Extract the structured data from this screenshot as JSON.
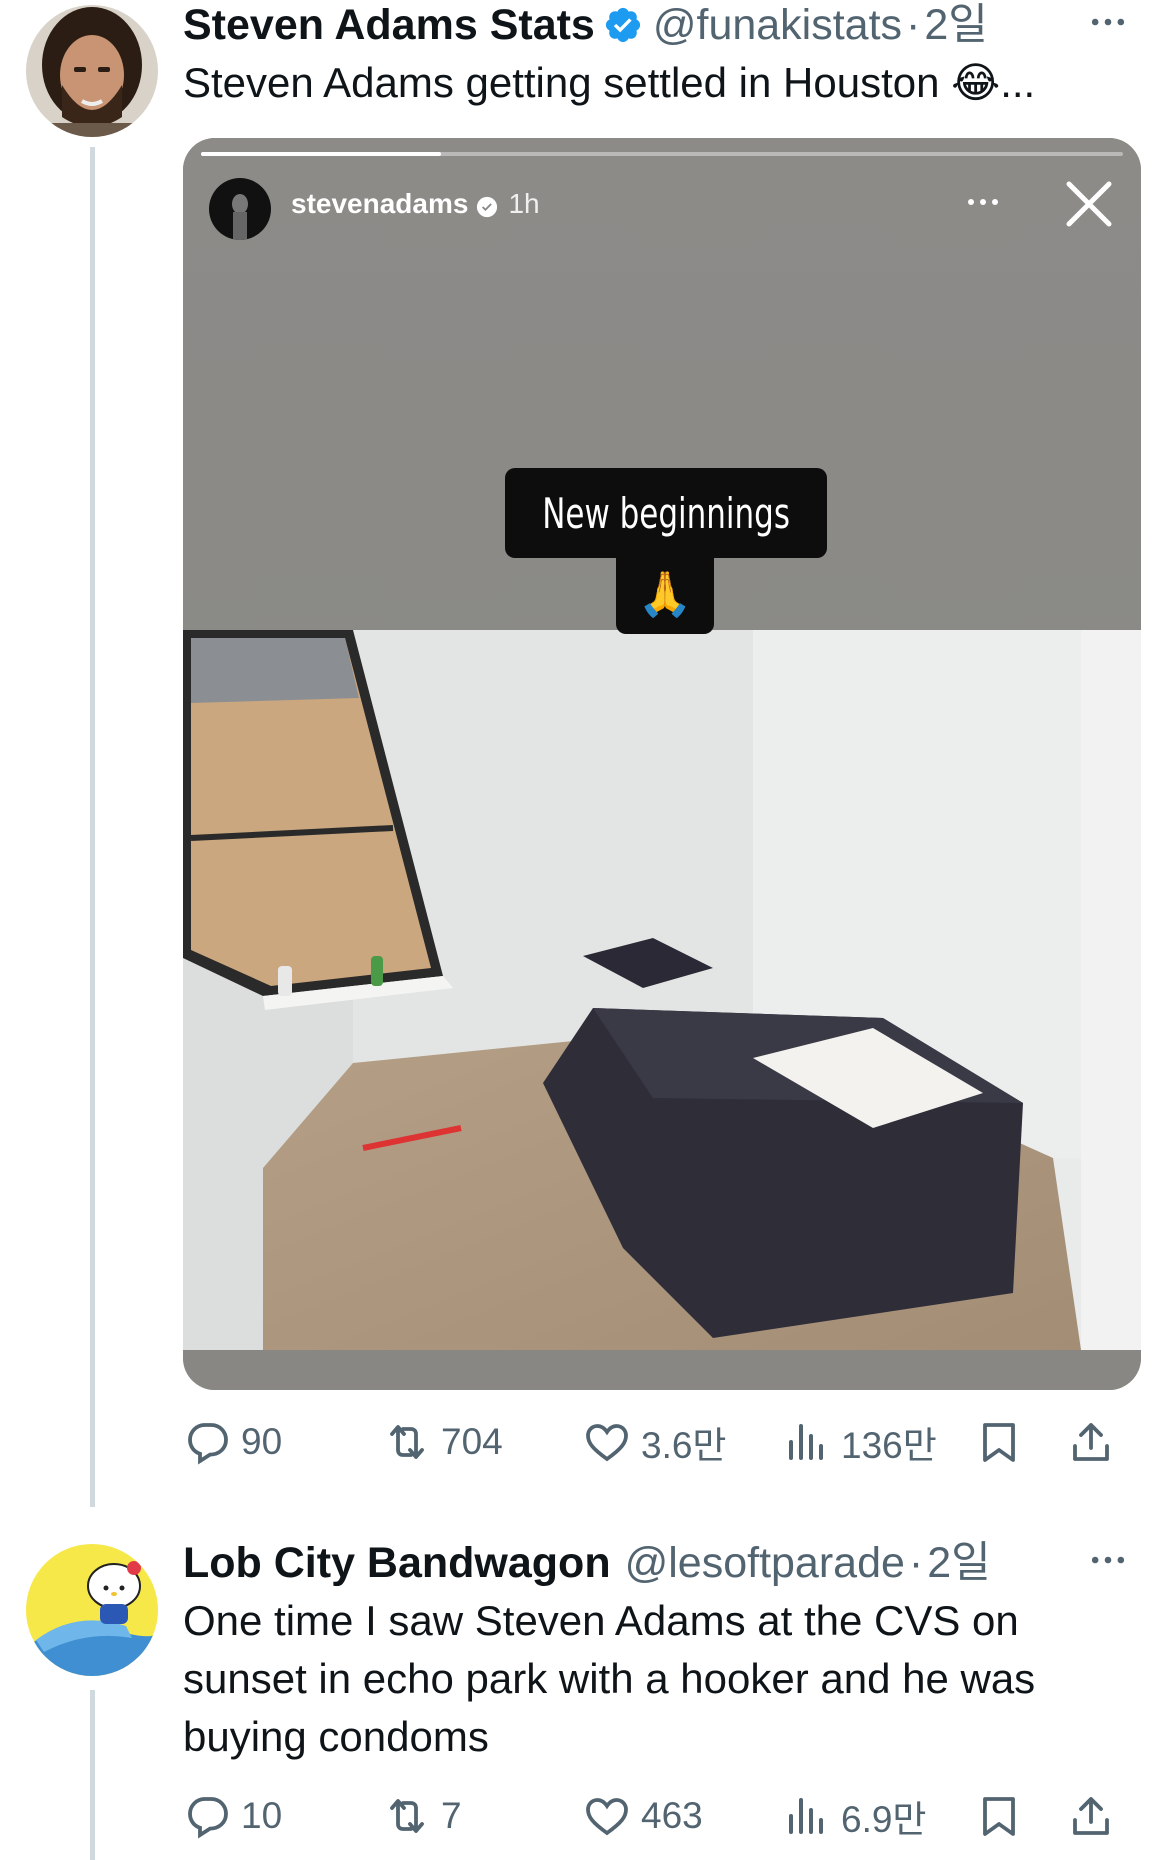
{
  "tweets": [
    {
      "name": "Steven Adams Stats",
      "handle": "@funakistats",
      "sep": "·",
      "time": "2일",
      "text": "Steven Adams getting settled in Houston 😂...",
      "story": {
        "username": "stevenadams",
        "time": "1h",
        "sticker_line1": "New beginnings",
        "sticker_emoji": "🙏"
      },
      "stats": {
        "replies": "90",
        "retweets": "704",
        "likes": "3.6만",
        "views": "136만"
      }
    },
    {
      "name": "Lob City Bandwagon",
      "handle": "@lesoftparade",
      "sep": "·",
      "time": "2일",
      "text": "One time I saw Steven Adams at the CVS on sunset in echo park with a hooker and he was buying condoms",
      "stats": {
        "replies": "10",
        "retweets": "7",
        "likes": "463",
        "views": "6.9만"
      }
    }
  ],
  "icons": {
    "more": "more-horizontal-icon",
    "verified": "verified-badge-icon",
    "reply": "reply-icon",
    "retweet": "retweet-icon",
    "like": "heart-icon",
    "views": "views-icon",
    "bookmark": "bookmark-icon",
    "share": "share-icon",
    "close": "close-icon"
  },
  "colors": {
    "accent": "#1d9bf0",
    "text": "#0f1419",
    "secondary": "#536471",
    "thread_line": "#cfd9de"
  }
}
